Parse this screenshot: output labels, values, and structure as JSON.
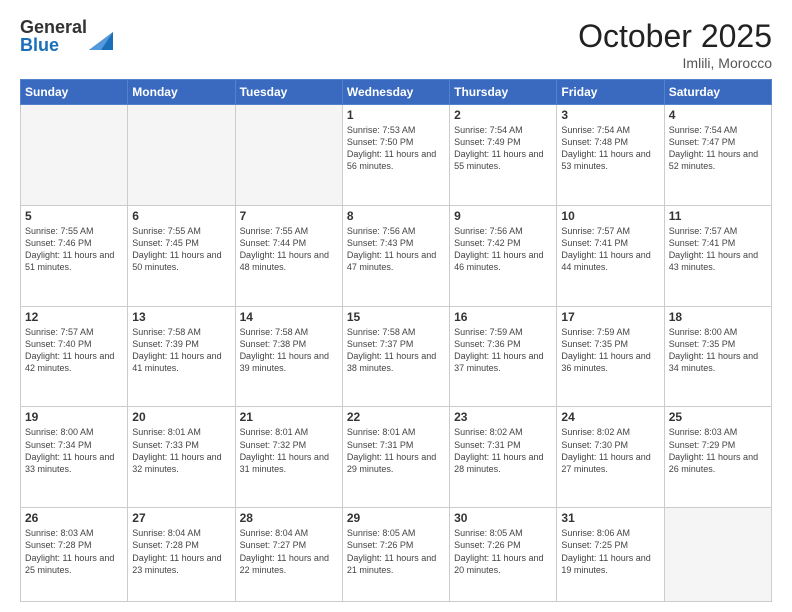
{
  "header": {
    "logo_general": "General",
    "logo_blue": "Blue",
    "month_title": "October 2025",
    "location": "Imlili, Morocco"
  },
  "days_of_week": [
    "Sunday",
    "Monday",
    "Tuesday",
    "Wednesday",
    "Thursday",
    "Friday",
    "Saturday"
  ],
  "weeks": [
    [
      {
        "day": "",
        "empty": true
      },
      {
        "day": "",
        "empty": true
      },
      {
        "day": "",
        "empty": true
      },
      {
        "day": "1",
        "sunrise": "7:53 AM",
        "sunset": "7:50 PM",
        "daylight": "11 hours and 56 minutes."
      },
      {
        "day": "2",
        "sunrise": "7:54 AM",
        "sunset": "7:49 PM",
        "daylight": "11 hours and 55 minutes."
      },
      {
        "day": "3",
        "sunrise": "7:54 AM",
        "sunset": "7:48 PM",
        "daylight": "11 hours and 53 minutes."
      },
      {
        "day": "4",
        "sunrise": "7:54 AM",
        "sunset": "7:47 PM",
        "daylight": "11 hours and 52 minutes."
      }
    ],
    [
      {
        "day": "5",
        "sunrise": "7:55 AM",
        "sunset": "7:46 PM",
        "daylight": "11 hours and 51 minutes."
      },
      {
        "day": "6",
        "sunrise": "7:55 AM",
        "sunset": "7:45 PM",
        "daylight": "11 hours and 50 minutes."
      },
      {
        "day": "7",
        "sunrise": "7:55 AM",
        "sunset": "7:44 PM",
        "daylight": "11 hours and 48 minutes."
      },
      {
        "day": "8",
        "sunrise": "7:56 AM",
        "sunset": "7:43 PM",
        "daylight": "11 hours and 47 minutes."
      },
      {
        "day": "9",
        "sunrise": "7:56 AM",
        "sunset": "7:42 PM",
        "daylight": "11 hours and 46 minutes."
      },
      {
        "day": "10",
        "sunrise": "7:57 AM",
        "sunset": "7:41 PM",
        "daylight": "11 hours and 44 minutes."
      },
      {
        "day": "11",
        "sunrise": "7:57 AM",
        "sunset": "7:41 PM",
        "daylight": "11 hours and 43 minutes."
      }
    ],
    [
      {
        "day": "12",
        "sunrise": "7:57 AM",
        "sunset": "7:40 PM",
        "daylight": "11 hours and 42 minutes."
      },
      {
        "day": "13",
        "sunrise": "7:58 AM",
        "sunset": "7:39 PM",
        "daylight": "11 hours and 41 minutes."
      },
      {
        "day": "14",
        "sunrise": "7:58 AM",
        "sunset": "7:38 PM",
        "daylight": "11 hours and 39 minutes."
      },
      {
        "day": "15",
        "sunrise": "7:58 AM",
        "sunset": "7:37 PM",
        "daylight": "11 hours and 38 minutes."
      },
      {
        "day": "16",
        "sunrise": "7:59 AM",
        "sunset": "7:36 PM",
        "daylight": "11 hours and 37 minutes."
      },
      {
        "day": "17",
        "sunrise": "7:59 AM",
        "sunset": "7:35 PM",
        "daylight": "11 hours and 36 minutes."
      },
      {
        "day": "18",
        "sunrise": "8:00 AM",
        "sunset": "7:35 PM",
        "daylight": "11 hours and 34 minutes."
      }
    ],
    [
      {
        "day": "19",
        "sunrise": "8:00 AM",
        "sunset": "7:34 PM",
        "daylight": "11 hours and 33 minutes."
      },
      {
        "day": "20",
        "sunrise": "8:01 AM",
        "sunset": "7:33 PM",
        "daylight": "11 hours and 32 minutes."
      },
      {
        "day": "21",
        "sunrise": "8:01 AM",
        "sunset": "7:32 PM",
        "daylight": "11 hours and 31 minutes."
      },
      {
        "day": "22",
        "sunrise": "8:01 AM",
        "sunset": "7:31 PM",
        "daylight": "11 hours and 29 minutes."
      },
      {
        "day": "23",
        "sunrise": "8:02 AM",
        "sunset": "7:31 PM",
        "daylight": "11 hours and 28 minutes."
      },
      {
        "day": "24",
        "sunrise": "8:02 AM",
        "sunset": "7:30 PM",
        "daylight": "11 hours and 27 minutes."
      },
      {
        "day": "25",
        "sunrise": "8:03 AM",
        "sunset": "7:29 PM",
        "daylight": "11 hours and 26 minutes."
      }
    ],
    [
      {
        "day": "26",
        "sunrise": "8:03 AM",
        "sunset": "7:28 PM",
        "daylight": "11 hours and 25 minutes."
      },
      {
        "day": "27",
        "sunrise": "8:04 AM",
        "sunset": "7:28 PM",
        "daylight": "11 hours and 23 minutes."
      },
      {
        "day": "28",
        "sunrise": "8:04 AM",
        "sunset": "7:27 PM",
        "daylight": "11 hours and 22 minutes."
      },
      {
        "day": "29",
        "sunrise": "8:05 AM",
        "sunset": "7:26 PM",
        "daylight": "11 hours and 21 minutes."
      },
      {
        "day": "30",
        "sunrise": "8:05 AM",
        "sunset": "7:26 PM",
        "daylight": "11 hours and 20 minutes."
      },
      {
        "day": "31",
        "sunrise": "8:06 AM",
        "sunset": "7:25 PM",
        "daylight": "11 hours and 19 minutes."
      },
      {
        "day": "",
        "empty": true
      }
    ]
  ]
}
